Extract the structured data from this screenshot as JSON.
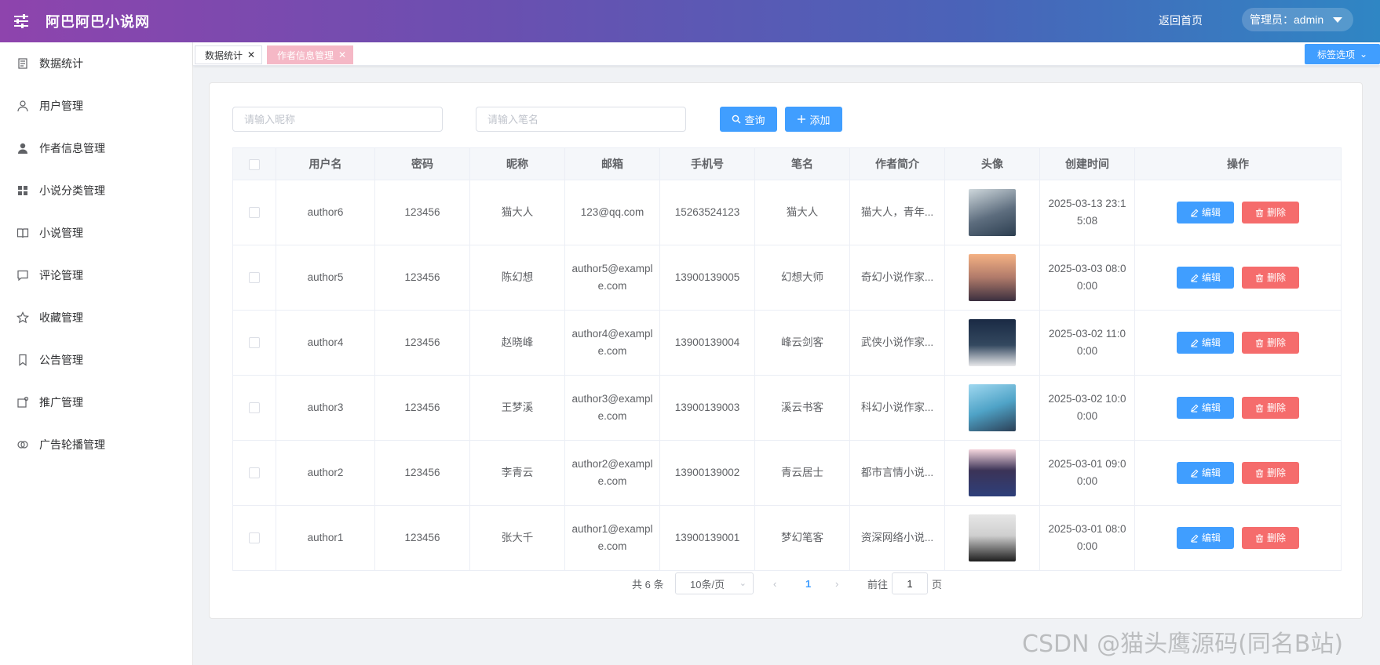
{
  "header": {
    "brand": "阿巴阿巴小说网",
    "home_link": "返回首页",
    "admin_label": "管理员：admin"
  },
  "sidebar": {
    "items": [
      {
        "label": "数据统计",
        "icon": "doc-icon"
      },
      {
        "label": "用户管理",
        "icon": "user-icon"
      },
      {
        "label": "作者信息管理",
        "icon": "user-filled-icon"
      },
      {
        "label": "小说分类管理",
        "icon": "grid-icon"
      },
      {
        "label": "小说管理",
        "icon": "book-icon"
      },
      {
        "label": "评论管理",
        "icon": "chat-icon"
      },
      {
        "label": "收藏管理",
        "icon": "star-icon"
      },
      {
        "label": "公告管理",
        "icon": "bookmark-icon"
      },
      {
        "label": "推广管理",
        "icon": "promo-icon"
      },
      {
        "label": "广告轮播管理",
        "icon": "carousel-icon"
      }
    ]
  },
  "tabs": {
    "items": [
      {
        "label": "数据统计",
        "active": false
      },
      {
        "label": "作者信息管理",
        "active": true
      }
    ],
    "options_label": "标签选项"
  },
  "search": {
    "nickname_placeholder": "请输入昵称",
    "penname_placeholder": "请输入笔名",
    "query_label": "查询",
    "add_label": "添加"
  },
  "table": {
    "columns": [
      "用户名",
      "密码",
      "昵称",
      "邮箱",
      "手机号",
      "笔名",
      "作者简介",
      "头像",
      "创建时间",
      "操作"
    ],
    "edit_label": "编辑",
    "delete_label": "删除",
    "rows": [
      {
        "username": "author6",
        "password": "123456",
        "nickname": "猫大人",
        "email": "123@qq.com",
        "phone": "15263524123",
        "penname": "猫大人",
        "intro": "猫大人，青年...",
        "created": "2025-03-13 23:15:08"
      },
      {
        "username": "author5",
        "password": "123456",
        "nickname": "陈幻想",
        "email": "author5@example.com",
        "phone": "13900139005",
        "penname": "幻想大师",
        "intro": "奇幻小说作家...",
        "created": "2025-03-03 08:00:00"
      },
      {
        "username": "author4",
        "password": "123456",
        "nickname": "赵晓峰",
        "email": "author4@example.com",
        "phone": "13900139004",
        "penname": "峰云剑客",
        "intro": "武侠小说作家...",
        "created": "2025-03-02 11:00:00"
      },
      {
        "username": "author3",
        "password": "123456",
        "nickname": "王梦溪",
        "email": "author3@example.com",
        "phone": "13900139003",
        "penname": "溪云书客",
        "intro": "科幻小说作家...",
        "created": "2025-03-02 10:00:00"
      },
      {
        "username": "author2",
        "password": "123456",
        "nickname": "李青云",
        "email": "author2@example.com",
        "phone": "13900139002",
        "penname": "青云居士",
        "intro": "都市言情小说...",
        "created": "2025-03-01 09:00:00"
      },
      {
        "username": "author1",
        "password": "123456",
        "nickname": "张大千",
        "email": "author1@example.com",
        "phone": "13900139001",
        "penname": "梦幻笔客",
        "intro": "资深网络小说...",
        "created": "2025-03-01 08:00:00"
      }
    ]
  },
  "pagination": {
    "total_text": "共 6 条",
    "page_size": "10条/页",
    "current_page": "1",
    "goto_label": "前往",
    "page_unit": "页",
    "jump_value": "1"
  },
  "watermark": "CSDN @猫头鹰源码(同名B站)",
  "colors": {
    "primary": "#409eff",
    "danger": "#f56c6c",
    "active_tag": "#f5b8c6",
    "header_start": "#8e44ad",
    "header_end": "#2f86c4"
  }
}
